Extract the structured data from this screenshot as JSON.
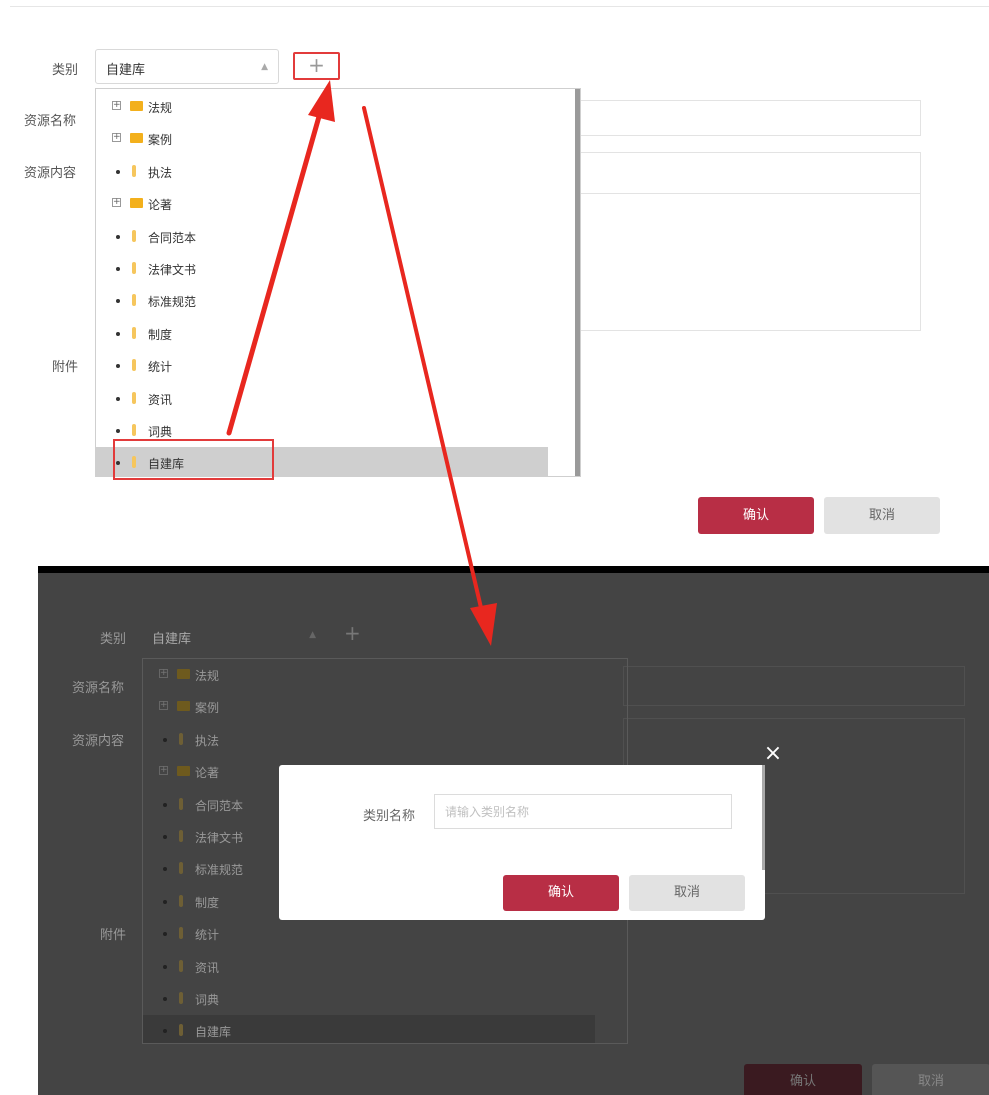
{
  "form": {
    "category_label": "类别",
    "category_value": "自建库",
    "add_symbol": "+",
    "resource_name_label": "资源名称",
    "resource_content_label": "资源内容",
    "attachment_label": "附件",
    "confirm_label": "确认",
    "cancel_label": "取消"
  },
  "tree": {
    "items": [
      {
        "label": "法规",
        "type": "folder"
      },
      {
        "label": "案例",
        "type": "folder"
      },
      {
        "label": "执法",
        "type": "leaf"
      },
      {
        "label": "论著",
        "type": "folder"
      },
      {
        "label": "合同范本",
        "type": "leaf"
      },
      {
        "label": "法律文书",
        "type": "leaf"
      },
      {
        "label": "标准规范",
        "type": "leaf"
      },
      {
        "label": "制度",
        "type": "leaf"
      },
      {
        "label": "统计",
        "type": "leaf"
      },
      {
        "label": "资讯",
        "type": "leaf"
      },
      {
        "label": "词典",
        "type": "leaf"
      },
      {
        "label": "自建库",
        "type": "leaf",
        "selected": true
      }
    ]
  },
  "modal": {
    "field_label": "类别名称",
    "input_placeholder": "请输入类别名称",
    "input_value": "",
    "confirm_label": "确认",
    "cancel_label": "取消",
    "close_symbol": "×"
  },
  "colors": {
    "primary": "#b82e45",
    "annotation": "#e23b3b",
    "folder": "#f3b01c"
  },
  "icons": {
    "expand": "plus-square-icon",
    "folder": "folder-icon",
    "leaf": "leaf-icon",
    "close": "close-icon",
    "dropdown": "chevron-up-icon"
  }
}
